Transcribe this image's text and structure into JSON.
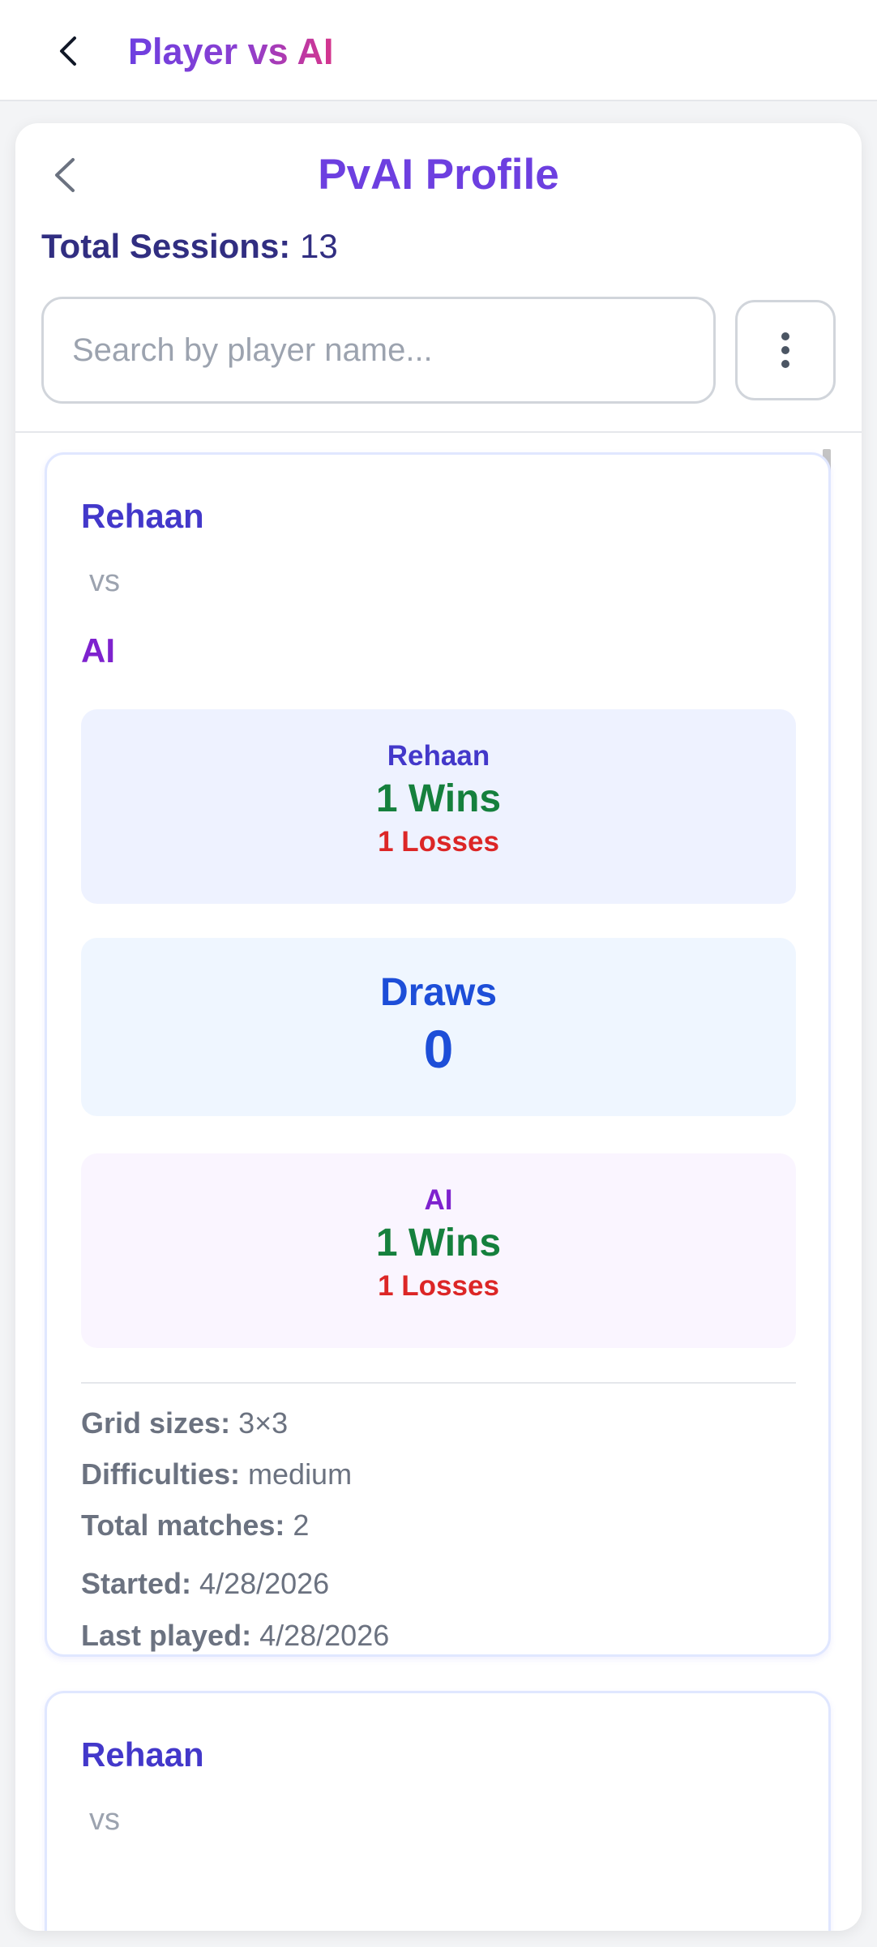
{
  "app": {
    "title": "Player vs AI"
  },
  "profile": {
    "title": "PvAI Profile",
    "sessions_label": "Total Sessions:",
    "sessions_value": "13",
    "search_placeholder": "Search by player name...",
    "search_value": ""
  },
  "icons": {
    "back": "chevron-left-icon",
    "menu": "more-vertical-icon"
  },
  "colors": {
    "accent": "#6d3fe0",
    "player": "#4338ca",
    "ai": "#7e22ce",
    "wins": "#15803d",
    "losses": "#dc2626",
    "draws": "#1d4ed8"
  },
  "sessions": [
    {
      "player": "Rehaan",
      "vs": "vs",
      "opponent": "AI",
      "player_stats": {
        "name": "Rehaan",
        "wins": "1 Wins",
        "losses": "1 Losses"
      },
      "draws": {
        "label": "Draws",
        "value": "0"
      },
      "ai_stats": {
        "name": "AI",
        "wins": "1 Wins",
        "losses": "1 Losses"
      },
      "meta": {
        "grid_label": "Grid sizes:",
        "grid_value": "3×3",
        "difficulty_label": "Difficulties:",
        "difficulty_value": "medium",
        "matches_label": "Total matches:",
        "matches_value": "2",
        "started_label": "Started:",
        "started_value": "4/28/2026",
        "last_label": "Last played:",
        "last_value": "4/28/2026"
      }
    },
    {
      "player": "Rehaan",
      "vs": "vs"
    }
  ]
}
